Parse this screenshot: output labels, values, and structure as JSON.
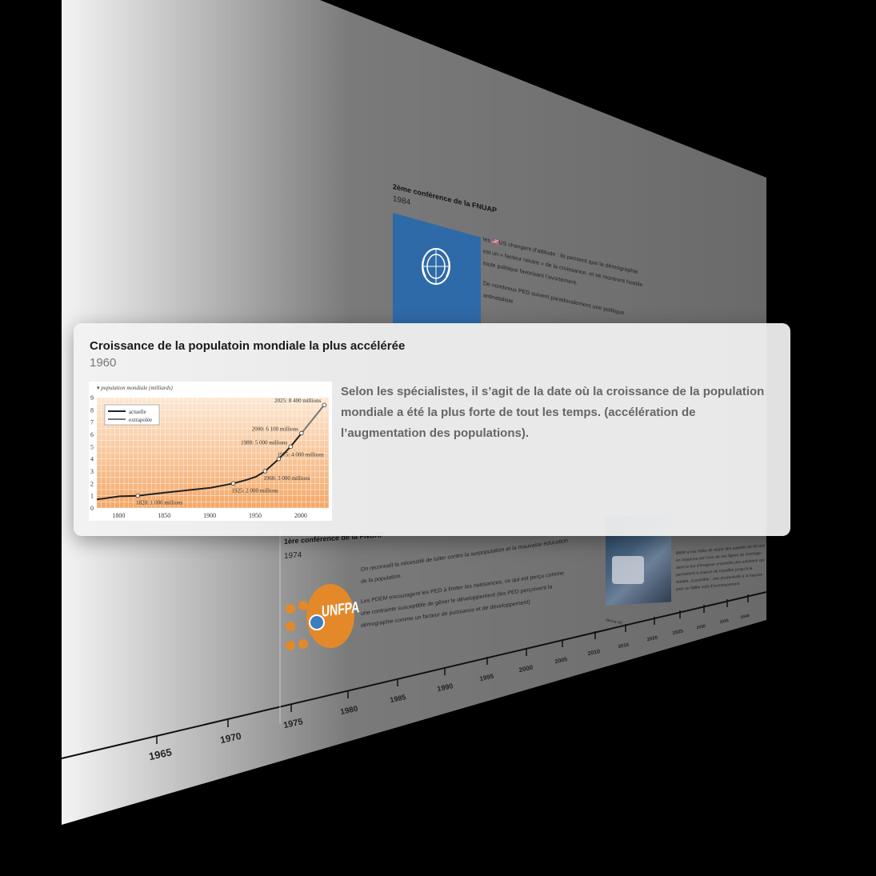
{
  "focused_event": {
    "title": "Croissance de la populatoin mondiale la plus accélérée",
    "year": "1960",
    "description": "Selon les spécialistes, il s’agit de la date où la croissance de la population mondiale a été la plus forte de tout les temps. (accélération de l’augmentation des populations)."
  },
  "background_events": {
    "fnuap_2": {
      "title": "2ème conférence de la FNUAP",
      "year": "1984",
      "text_1": "les 🇺🇸US changent d’attitude : ils pensent que la démographie est un « facteur neutre » de la croissance, et se montrent hostile toute politique favorisant l’avortement.",
      "text_2": "De nombreux PED suivent paradoxalement une politique antinataliste"
    },
    "fnuap_1": {
      "title": "1ère conférence de la FNUAP",
      "year": "1974",
      "text_1": "On reconnaît la nécessité de lutter contre la surpopulation et la mauvaise éducation de la population.",
      "text_2": "Les PDEM encouragent les PED à limiter les naissances, ce qui est perçu comme une contrainte susceptible de gêner le développement (les PED perçoivent la démographie comme un facteur de puissance et de développement)",
      "logo_text": "UNFPA"
    },
    "bmw": {
      "text": "BMW a mis l’idée de réunir des salariés de 60 ans en moyenne sur l’une de ses lignes de montage, dans le but d’imaginer ensemble des solutions qui permettent à chacun de travailler jusqu’à la retraite, si possible ; une productivité à la hausse pour un faible coût d’investissement",
      "caption": "Jeune AC"
    }
  },
  "timeline": {
    "ticks": [
      "1965",
      "1970",
      "1975",
      "1980",
      "1985",
      "1990",
      "1995",
      "2000",
      "2005",
      "2010",
      "2015",
      "2020",
      "2025",
      "2030",
      "2035",
      "2040"
    ]
  },
  "colors": {
    "un_blue": "#2f6aa8",
    "unfpa_orange": "#e3892a",
    "chart_orange": "#f6b97a"
  },
  "chart_data": {
    "type": "line",
    "title": "population mondiale (milliards)",
    "xlabel": "",
    "ylabel": "",
    "xlim": [
      1775,
      2030
    ],
    "ylim": [
      0,
      9
    ],
    "xticks": [
      1800,
      1850,
      1900,
      1950,
      2000
    ],
    "yticks": [
      0,
      1,
      2,
      3,
      4,
      5,
      6,
      7,
      8,
      9
    ],
    "grid": true,
    "legend_position": "top-left",
    "series": [
      {
        "name": "actuelle",
        "x": [
          1775,
          1800,
          1820,
          1850,
          1875,
          1900,
          1925,
          1940,
          1950,
          1960,
          1975,
          1988,
          2000
        ],
        "values": [
          0.7,
          0.95,
          1.0,
          1.25,
          1.45,
          1.65,
          2.0,
          2.3,
          2.55,
          3.0,
          4.0,
          5.0,
          6.1
        ]
      },
      {
        "name": "extrapolée",
        "x": [
          2000,
          2025
        ],
        "values": [
          6.1,
          8.4
        ]
      }
    ],
    "annotations": [
      {
        "x": 1820,
        "y": 1.0,
        "label": "1820: 1 000 millions"
      },
      {
        "x": 1925,
        "y": 2.0,
        "label": "1925: 2 000 millions"
      },
      {
        "x": 1960,
        "y": 3.0,
        "label": "1960: 3 000 millions"
      },
      {
        "x": 1975,
        "y": 4.0,
        "label": "1975: 4 000 millions"
      },
      {
        "x": 1988,
        "y": 5.0,
        "label": "1988: 5 000 millions"
      },
      {
        "x": 2000,
        "y": 6.1,
        "label": "2000: 6 100 millions"
      },
      {
        "x": 2025,
        "y": 8.4,
        "label": "2025: 8 400 millions"
      }
    ]
  }
}
